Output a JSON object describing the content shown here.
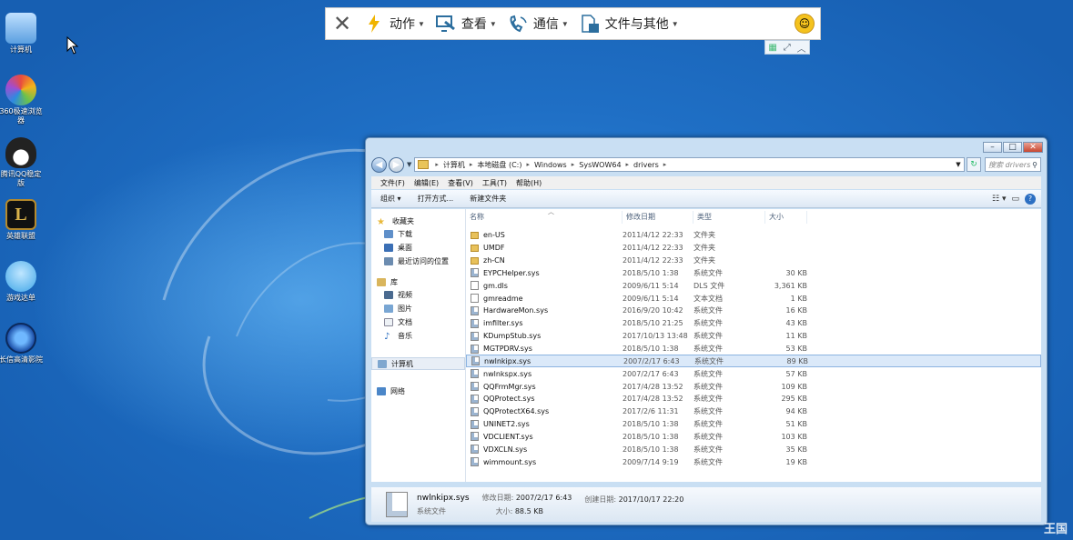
{
  "desktop": {
    "icons": [
      {
        "label": "计算机",
        "icon": "computer-icon",
        "color": "#5b9fe0"
      },
      {
        "label": "360极速浏览器",
        "icon": "browser-360-icon",
        "color": "#e94c3d"
      },
      {
        "label": "腾讯QQ稳定版",
        "icon": "qq-penguin-icon",
        "color": "#222222"
      },
      {
        "label": "英雄联盟",
        "icon": "league-icon",
        "color": "#b58a2c"
      },
      {
        "label": "游戏达单",
        "icon": "game-cloud-icon",
        "color": "#3fa6e8"
      },
      {
        "label": "长信高清影院",
        "icon": "media-player-icon",
        "color": "#1b4fa8"
      }
    ],
    "watermark": "王国"
  },
  "remote_toolbar": {
    "close_icon": "close-icon",
    "items": [
      {
        "label": "动作",
        "icon": "lightning-icon",
        "icon_color": "#f0b400"
      },
      {
        "label": "查看",
        "icon": "view-monitor-icon",
        "icon_color": "#2c6e9e"
      },
      {
        "label": "通信",
        "icon": "phone-icon",
        "icon_color": "#2c6e9e"
      },
      {
        "label": "文件与其他",
        "icon": "files-icon",
        "icon_color": "#2c6e9e"
      }
    ],
    "smile_icon": "smiley-icon"
  },
  "explorer": {
    "address": {
      "segments": [
        "计算机",
        "本地磁盘 (C:)",
        "Windows",
        "SysWOW64",
        "drivers"
      ]
    },
    "search_placeholder": "搜索 drivers",
    "menu": [
      "文件(F)",
      "编辑(E)",
      "查看(V)",
      "工具(T)",
      "帮助(H)"
    ],
    "commands": [
      "组织 ▾",
      "打开方式...",
      "新建文件夹"
    ],
    "nav": {
      "favorites": "收藏夹",
      "favorites_items": [
        "下载",
        "桌面",
        "最近访问的位置"
      ],
      "library": "库",
      "library_items": [
        "视频",
        "图片",
        "文档",
        "音乐"
      ],
      "computer": "计算机",
      "network": "网络"
    },
    "columns": [
      "名称",
      "修改日期",
      "类型",
      "大小"
    ],
    "files": [
      {
        "name": "en-US",
        "date": "2011/4/12 22:33",
        "type": "文件夹",
        "size": "",
        "kind": "folder"
      },
      {
        "name": "UMDF",
        "date": "2011/4/12 22:33",
        "type": "文件夹",
        "size": "",
        "kind": "folder"
      },
      {
        "name": "zh-CN",
        "date": "2011/4/12 22:33",
        "type": "文件夹",
        "size": "",
        "kind": "folder"
      },
      {
        "name": "EYPCHelper.sys",
        "date": "2018/5/10 1:38",
        "type": "系统文件",
        "size": "30 KB",
        "kind": "sys"
      },
      {
        "name": "gm.dls",
        "date": "2009/6/11 5:14",
        "type": "DLS 文件",
        "size": "3,361 KB",
        "kind": "file"
      },
      {
        "name": "gmreadme",
        "date": "2009/6/11 5:14",
        "type": "文本文档",
        "size": "1 KB",
        "kind": "file"
      },
      {
        "name": "HardwareMon.sys",
        "date": "2016/9/20 10:42",
        "type": "系统文件",
        "size": "16 KB",
        "kind": "sys"
      },
      {
        "name": "imfilter.sys",
        "date": "2018/5/10 21:25",
        "type": "系统文件",
        "size": "43 KB",
        "kind": "sys"
      },
      {
        "name": "KDumpStub.sys",
        "date": "2017/10/13 13:48",
        "type": "系统文件",
        "size": "11 KB",
        "kind": "sys"
      },
      {
        "name": "MGTPDRV.sys",
        "date": "2018/5/10 1:38",
        "type": "系统文件",
        "size": "53 KB",
        "kind": "sys"
      },
      {
        "name": "nwlnkipx.sys",
        "date": "2007/2/17 6:43",
        "type": "系统文件",
        "size": "89 KB",
        "kind": "sys",
        "selected": true
      },
      {
        "name": "nwlnkspx.sys",
        "date": "2007/2/17 6:43",
        "type": "系统文件",
        "size": "57 KB",
        "kind": "sys"
      },
      {
        "name": "QQFrmMgr.sys",
        "date": "2017/4/28 13:52",
        "type": "系统文件",
        "size": "109 KB",
        "kind": "sys"
      },
      {
        "name": "QQProtect.sys",
        "date": "2017/4/28 13:52",
        "type": "系统文件",
        "size": "295 KB",
        "kind": "sys"
      },
      {
        "name": "QQProtectX64.sys",
        "date": "2017/2/6 11:31",
        "type": "系统文件",
        "size": "94 KB",
        "kind": "sys"
      },
      {
        "name": "UNINET2.sys",
        "date": "2018/5/10 1:38",
        "type": "系统文件",
        "size": "51 KB",
        "kind": "sys"
      },
      {
        "name": "VDCLIENT.sys",
        "date": "2018/5/10 1:38",
        "type": "系统文件",
        "size": "103 KB",
        "kind": "sys"
      },
      {
        "name": "VDXCLN.sys",
        "date": "2018/5/10 1:38",
        "type": "系统文件",
        "size": "35 KB",
        "kind": "sys"
      },
      {
        "name": "wimmount.sys",
        "date": "2009/7/14 9:19",
        "type": "系统文件",
        "size": "19 KB",
        "kind": "sys"
      }
    ],
    "details": {
      "filename": "nwlnkipx.sys",
      "filetype": "系统文件",
      "modified_label": "修改日期:",
      "modified": "2007/2/17 6:43",
      "size_label": "大小:",
      "size": "88.5 KB",
      "created_label": "创建日期:",
      "created": "2017/10/17 22:20"
    }
  }
}
